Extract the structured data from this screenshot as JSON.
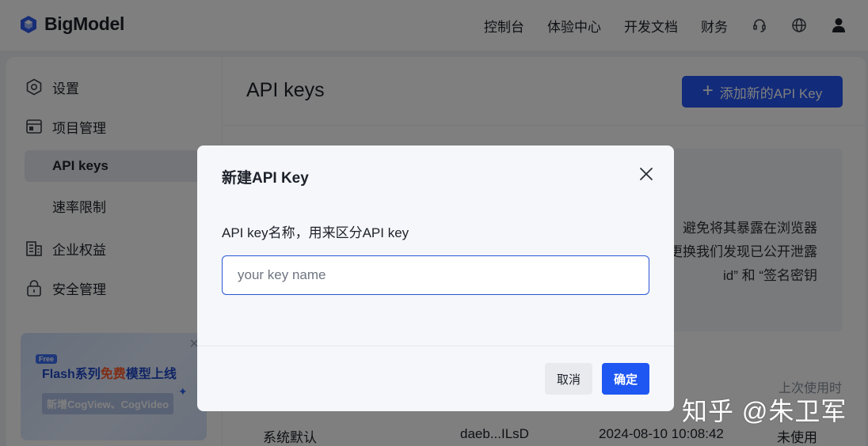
{
  "brand": {
    "name": "BigModel"
  },
  "nav": {
    "links": [
      "控制台",
      "体验中心",
      "开发文档",
      "财务"
    ],
    "icons": [
      "headset-icon",
      "globe-icon",
      "user-icon"
    ]
  },
  "sidebar": {
    "items": [
      {
        "label": "设置",
        "icon": "settings-icon"
      },
      {
        "label": "项目管理",
        "icon": "window-icon"
      },
      {
        "label": "API keys"
      },
      {
        "label": "速率限制"
      },
      {
        "label": "企业权益",
        "icon": "building-icon"
      },
      {
        "label": "安全管理",
        "icon": "lock-icon"
      }
    ],
    "promo": {
      "badge": "Free",
      "title_prefix": "Flash系列",
      "title_highlight": "免费",
      "title_suffix": "模型上线",
      "subtitle": "新增CogView、CogVideo"
    }
  },
  "main": {
    "title": "API keys",
    "add_button": "添加新的API Key",
    "notice_lines": [
      "避免将其暴露在浏览器",
      "更换我们发现已公开泄露",
      "id” 和 “签名密钥"
    ],
    "column_last_used": "上次使用时",
    "row": {
      "name": "系统默认",
      "key": "daeb...ILsD",
      "created": "2024-08-10 10:08:42",
      "last_used": "未使用"
    }
  },
  "modal": {
    "title": "新建API Key",
    "label": "API key名称，用来区分API key",
    "input_placeholder": "your key name",
    "input_value": "",
    "cancel": "取消",
    "confirm": "确定"
  },
  "watermark": "知乎 @朱卫军",
  "colors": {
    "primary": "#2457f5",
    "overlay": "rgba(0,0,0,0.5)"
  }
}
